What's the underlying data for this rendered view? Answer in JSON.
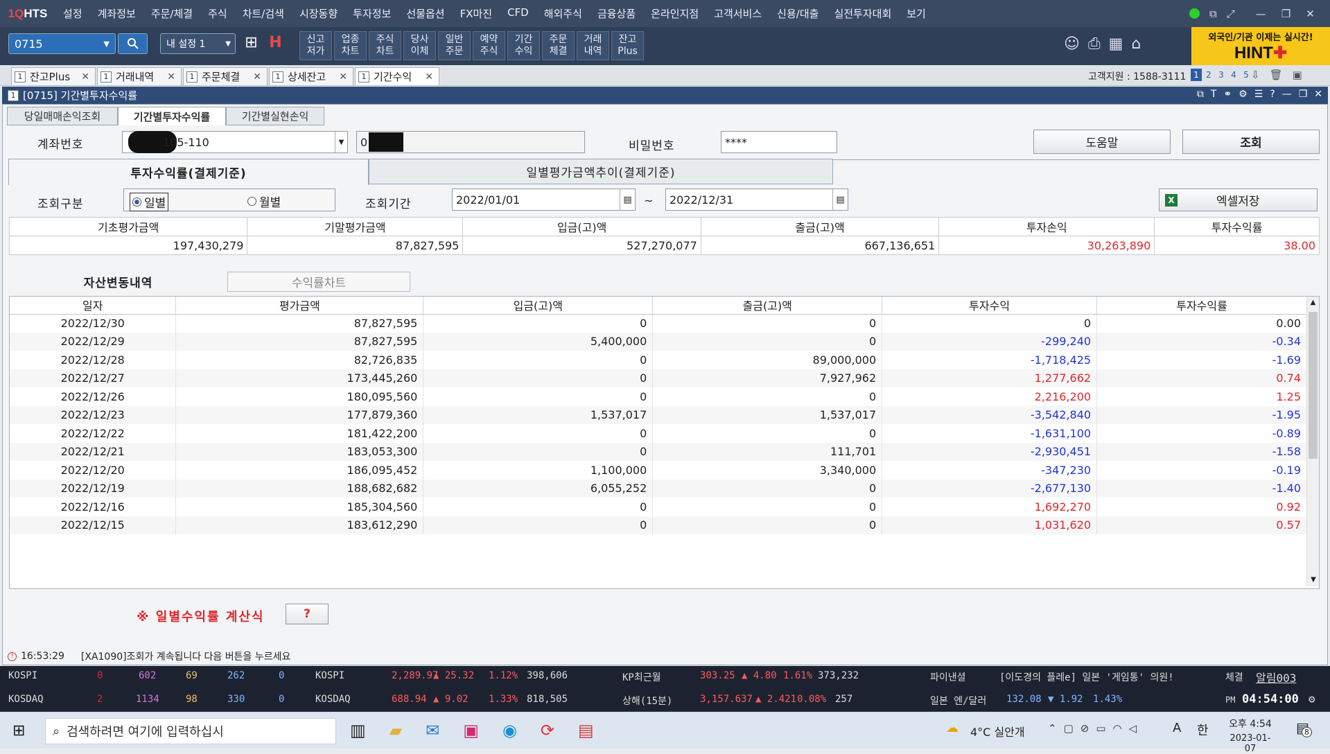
{
  "menubar": {
    "logo_a": "1Q",
    "logo_b": "HTS",
    "items": [
      "설정",
      "계좌정보",
      "주문/체결",
      "주식",
      "차트/검색",
      "시장동향",
      "투자정보",
      "선물옵션",
      "FX마진",
      "CFD",
      "해외주식",
      "금융상품",
      "온라인지점",
      "고객서비스",
      "신용/대출",
      "실전투자대회",
      "보기"
    ]
  },
  "toolbar": {
    "screen_no": "0715",
    "my_setting": "내 설정 1",
    "buttons": [
      "신고\n저가",
      "업종\n차트",
      "주식\n차트",
      "당사\n이체",
      "일반\n주문",
      "예약\n주식",
      "기간\n수익",
      "주문\n체결",
      "거래\n내역",
      "잔고\nPlus"
    ],
    "hint_line1": "외국인/기관 이제는 실시간!",
    "hint_line2": "HINT"
  },
  "window_tabs": [
    {
      "num": "1",
      "label": "잔고Plus"
    },
    {
      "num": "1",
      "label": "거래내역"
    },
    {
      "num": "1",
      "label": "주문체결"
    },
    {
      "num": "1",
      "label": "상세잔고"
    },
    {
      "num": "1",
      "label": "기간수익"
    }
  ],
  "support": {
    "label": "고객지원 : 1588-3111",
    "pages": [
      "1",
      "2",
      "3",
      "4",
      "5"
    ]
  },
  "window_title": "[0715] 기간별투자수익률",
  "subtabs": [
    "당일매매손익조회",
    "기간별투자수익률",
    "기간별실현손익"
  ],
  "form": {
    "account_label": "계좌번호",
    "account_value": "105-110",
    "account_name": "0",
    "password_label": "비밀번호",
    "password_value": "****",
    "help_button": "도움말",
    "query_button": "조회",
    "mode_tab_active": "투자수익률(결제기준)",
    "mode_tab_other": "일별평가금액추이(결제기준)",
    "query_type_label": "조회구분",
    "radio_daily": "일별",
    "radio_monthly": "월별",
    "period_label": "조회기간",
    "date_from": "2022/01/01",
    "date_sep": "~",
    "date_to": "2022/12/31",
    "excel_button": "엑셀저장"
  },
  "summary": {
    "headers": [
      "기초평가금액",
      "기말평가금액",
      "입금(고)액",
      "출금(고)액",
      "투자손익",
      "투자수익률"
    ],
    "values": [
      "197,430,279",
      "87,827,595",
      "527,270,077",
      "667,136,651",
      "30,263,890",
      "38.00"
    ]
  },
  "section_tabs": [
    "자산변동내역",
    "수익률차트"
  ],
  "grid": {
    "headers": [
      "일자",
      "평가금액",
      "입금(고)액",
      "출금(고)액",
      "투자수익",
      "투자수익률"
    ],
    "rows": [
      [
        "2022/12/30",
        "87,827,595",
        "0",
        "0",
        "0",
        "0.00"
      ],
      [
        "2022/12/29",
        "87,827,595",
        "5,400,000",
        "0",
        "-299,240",
        "-0.34"
      ],
      [
        "2022/12/28",
        "82,726,835",
        "0",
        "89,000,000",
        "-1,718,425",
        "-1.69"
      ],
      [
        "2022/12/27",
        "173,445,260",
        "0",
        "7,927,962",
        "1,277,662",
        "0.74"
      ],
      [
        "2022/12/26",
        "180,095,560",
        "0",
        "0",
        "2,216,200",
        "1.25"
      ],
      [
        "2022/12/23",
        "177,879,360",
        "1,537,017",
        "1,537,017",
        "-3,542,840",
        "-1.95"
      ],
      [
        "2022/12/22",
        "181,422,200",
        "0",
        "0",
        "-1,631,100",
        "-0.89"
      ],
      [
        "2022/12/21",
        "183,053,300",
        "0",
        "111,701",
        "-2,930,451",
        "-1.58"
      ],
      [
        "2022/12/20",
        "186,095,452",
        "1,100,000",
        "3,340,000",
        "-347,230",
        "-0.19"
      ],
      [
        "2022/12/19",
        "188,682,682",
        "6,055,252",
        "0",
        "-2,677,130",
        "-1.40"
      ],
      [
        "2022/12/16",
        "185,304,560",
        "0",
        "0",
        "1,692,270",
        "0.92"
      ],
      [
        "2022/12/15",
        "183,612,290",
        "0",
        "0",
        "1,031,620",
        "0.57"
      ]
    ]
  },
  "formula": {
    "label": "※ 일별수익률 계산식",
    "button": "?"
  },
  "status": {
    "time": "16:53:29",
    "message": "[XA1090]조회가 계속됩니다 다음 버튼을 누르세요"
  },
  "ticker": {
    "row1": {
      "idx": "KOSPI",
      "c1": "0",
      "c2": "602",
      "c3": "69",
      "c4": "262",
      "c5": "0",
      "name": "KOSPI",
      "price": "2,289.97",
      "chg": "▲ 25.32",
      "pct": "1.12%",
      "vol": "398,606",
      "name2": "KP최근월",
      "price2": "303.25",
      "chg2": "▲ 4.80",
      "pct2": "1.61%",
      "vol2": "373,232",
      "news_label": "파이낸셜",
      "news": "[이도경의 플레e] 일본 '게임통' 의원!",
      "right_a": "체결",
      "right_b": "알림003"
    },
    "row2": {
      "idx": "KOSDAQ",
      "c1": "2",
      "c2": "1134",
      "c3": "98",
      "c4": "330",
      "c5": "0",
      "name": "KOSDAQ",
      "price": "688.94",
      "chg": "▲ 9.02",
      "pct": "1.33%",
      "vol": "818,505",
      "name2": "상해(15분)",
      "price2": "3,157.637",
      "chg2": "▲ 2.421",
      "pct2": "0.08%",
      "vol2": "257",
      "fx_label": "일본 엔/달러",
      "fx": "132.08",
      "fx_chg": "▼ 1.92",
      "fx_pct": "1.43%",
      "ampm": "PM",
      "clock": "04:54:00"
    }
  },
  "taskbar": {
    "search_placeholder": "검색하려면 여기에 입력하십시",
    "weather": "4°C 실안개",
    "ime": "A",
    "lang": "한",
    "time": "오후 4:54",
    "date": "2023-01-07",
    "notif": "8"
  },
  "colors": {
    "positive": "#e0262d",
    "negative": "#1f34d8",
    "title_bar": "#2f4b77"
  }
}
